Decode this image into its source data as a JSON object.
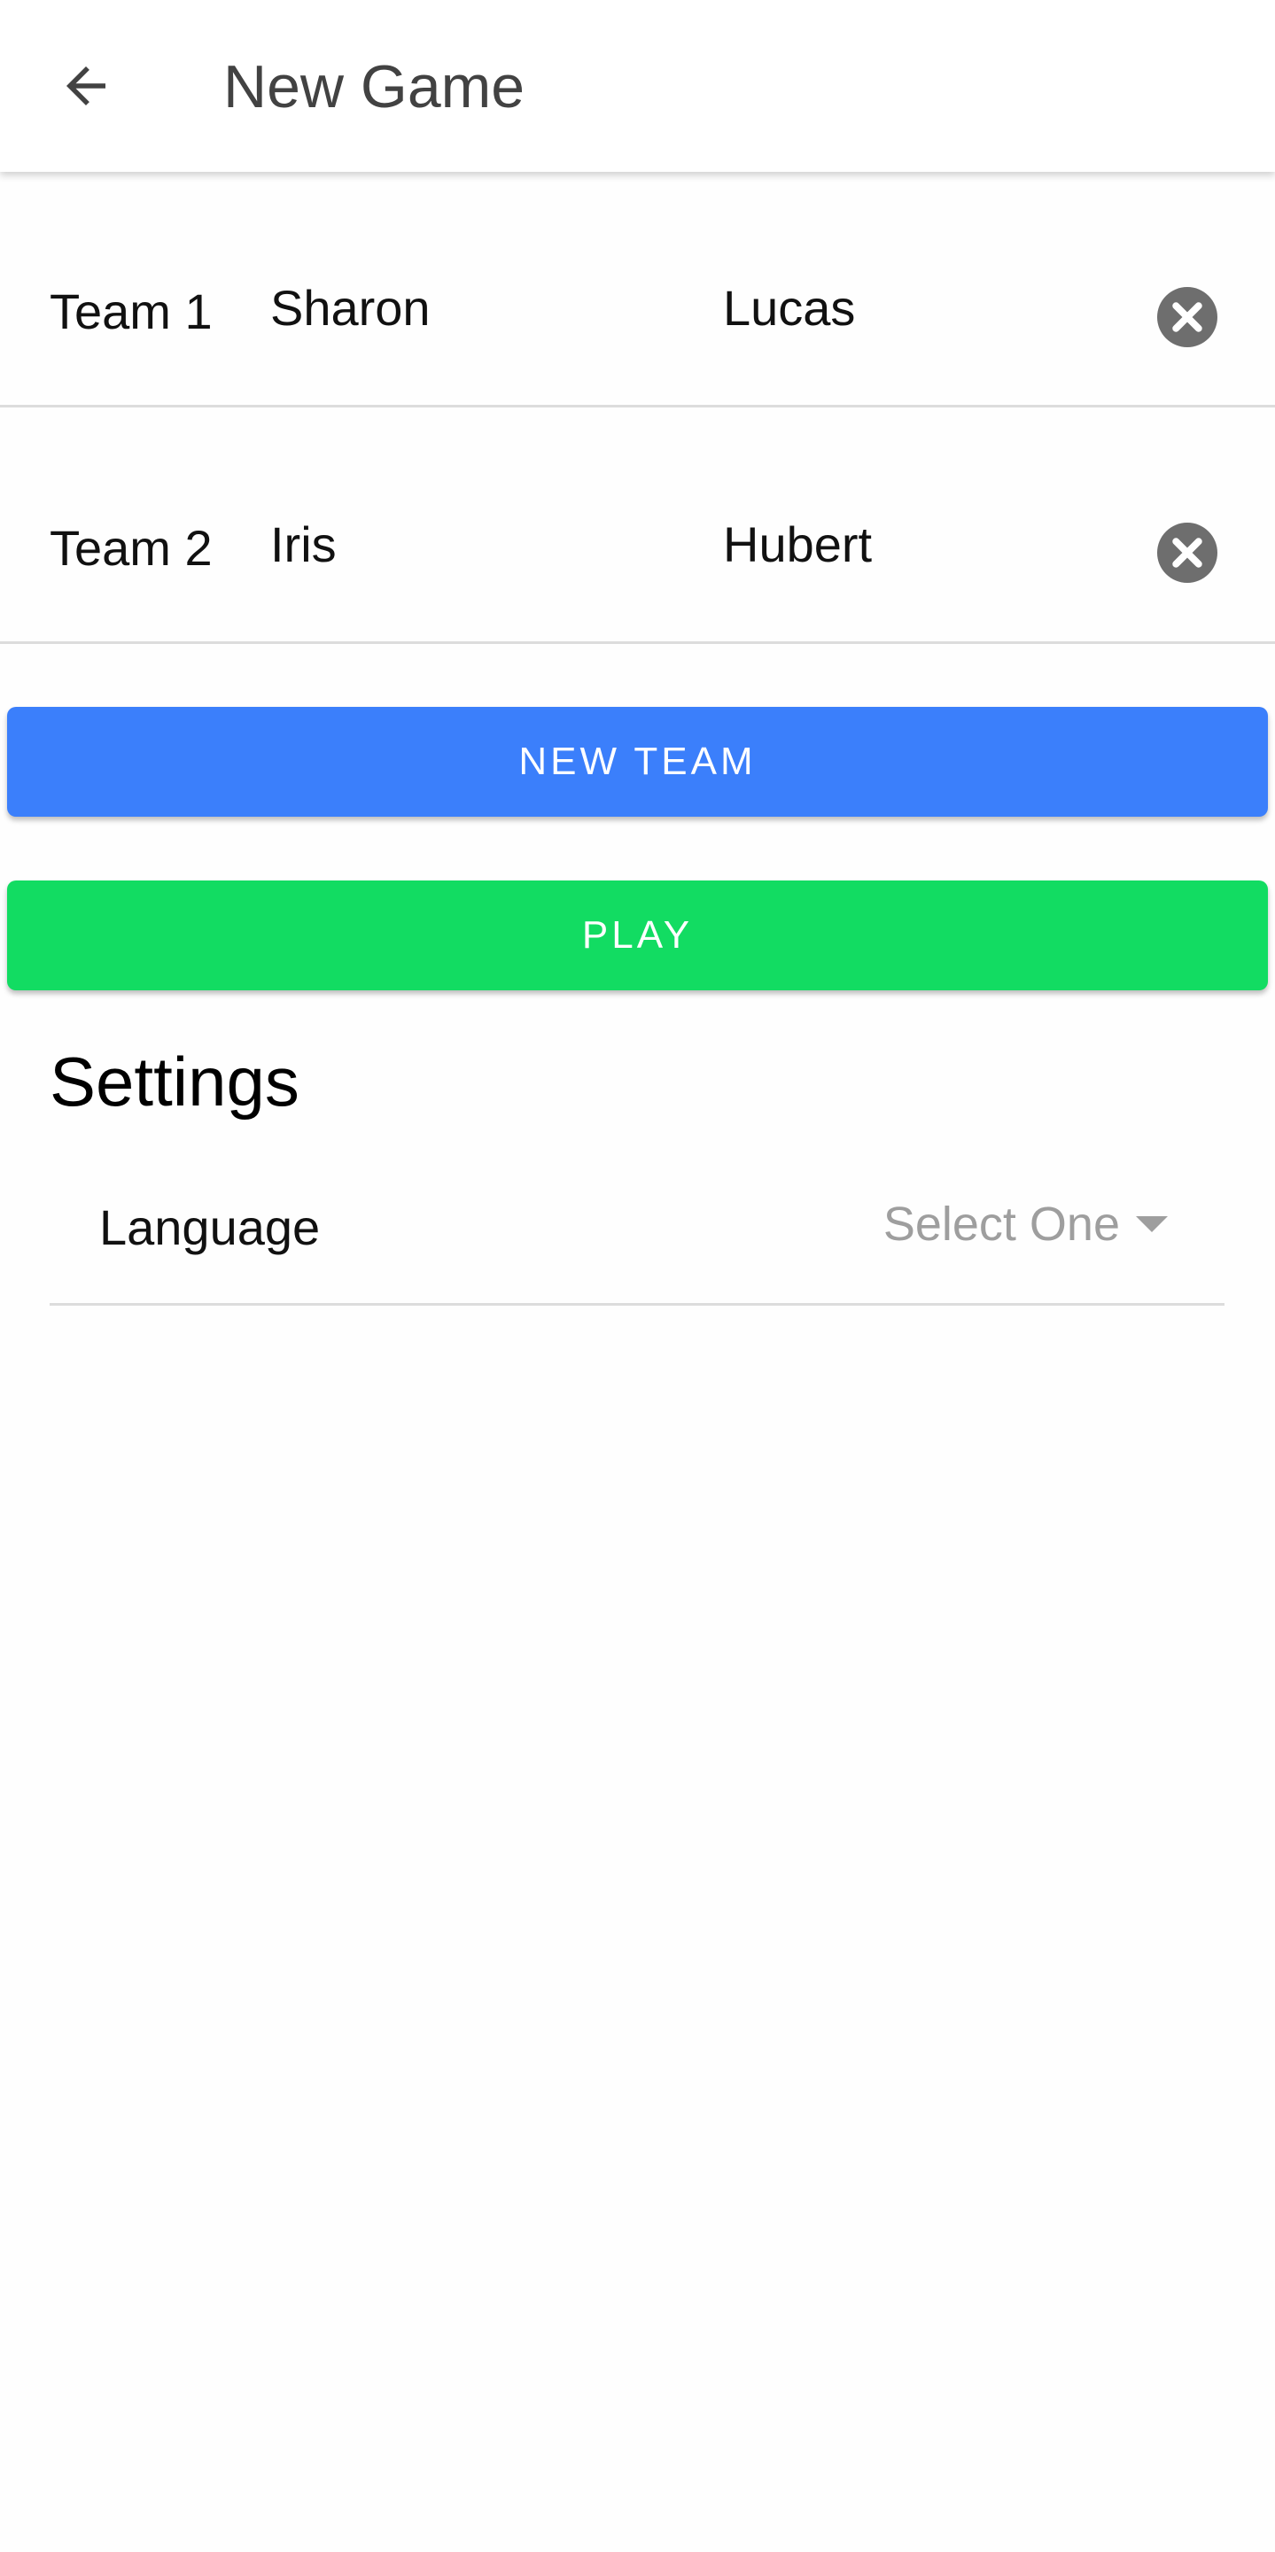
{
  "toolbar": {
    "back_icon": "arrow-left-icon",
    "title": "New Game"
  },
  "teams": [
    {
      "label": "Team 1",
      "player1": "Sharon",
      "player2": "Lucas",
      "remove_icon": "close-circle-icon"
    },
    {
      "label": "Team 2",
      "player1": "Iris",
      "player2": "Hubert",
      "remove_icon": "close-circle-icon"
    }
  ],
  "buttons": {
    "new_team": "NEW TEAM",
    "play": "PLAY"
  },
  "settings": {
    "heading": "Settings",
    "language": {
      "label": "Language",
      "placeholder": "Select One"
    }
  },
  "colors": {
    "new_team_button": "#3b7ffb",
    "play_button": "#12dc62",
    "remove_icon": "#6e6e6e",
    "placeholder_text": "#9e9e9e"
  }
}
